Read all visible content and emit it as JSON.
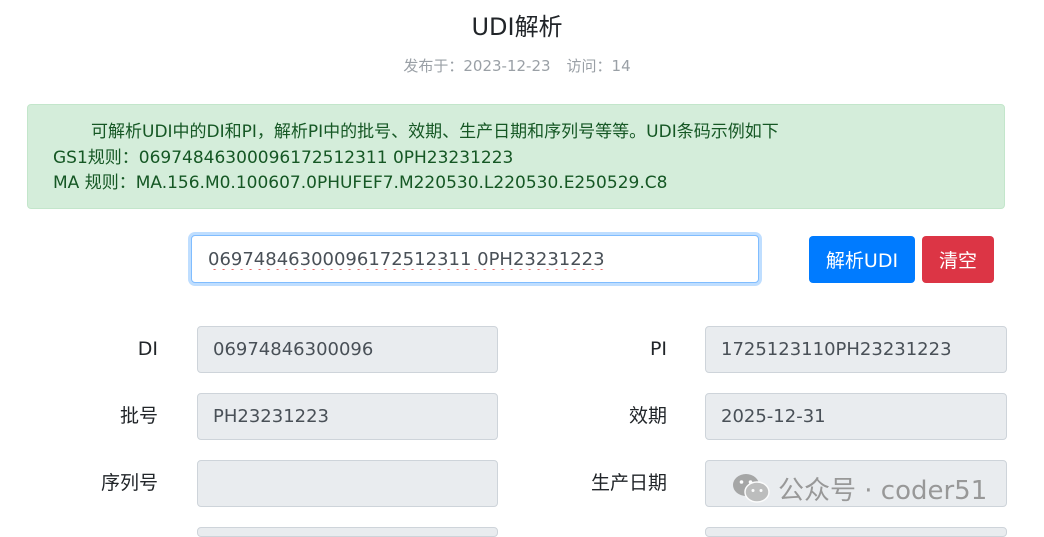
{
  "page": {
    "title": "UDI解析",
    "published_label": "发布于：2023-12-23",
    "visits_label": "访问：14"
  },
  "info": {
    "intro": "可解析UDI中的DI和PI，解析PI中的批号、效期、生产日期和序列号等等。UDI条码示例如下",
    "gs1": "GS1规则：06974846300096172512311 0PH23231223",
    "ma": "MA 规则：MA.156.M0.100607.0PHUFEF7.M220530.L220530.E250529.C8"
  },
  "input": {
    "value": "06974846300096172512311 0PH23231223"
  },
  "buttons": {
    "parse": "解析UDI",
    "clear": "清空"
  },
  "fields": {
    "di": {
      "label": "DI",
      "value": "06974846300096"
    },
    "pi": {
      "label": "PI",
      "value": "1725123110PH23231223"
    },
    "batch": {
      "label": "批号",
      "value": "PH23231223"
    },
    "expiry": {
      "label": "效期",
      "value": "2025-12-31"
    },
    "serial": {
      "label": "序列号",
      "value": ""
    },
    "production_date": {
      "label": "生产日期",
      "value": ""
    }
  },
  "watermark": {
    "text": "公众号 · coder51",
    "icon": "wechat-icon"
  },
  "colors": {
    "primary": "#007bff",
    "danger": "#dc3545",
    "alert_bg": "#d4edda",
    "alert_text": "#155724"
  }
}
